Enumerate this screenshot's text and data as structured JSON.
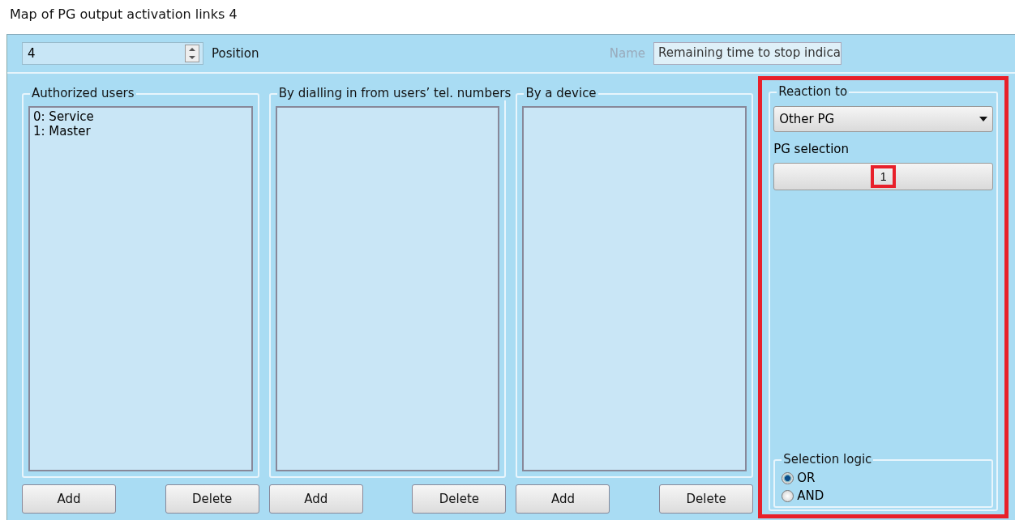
{
  "window": {
    "title": "Map of PG output activation links 4"
  },
  "toolbar": {
    "position_value": "4",
    "position_label": "Position",
    "name_label": "Name",
    "name_value": "Remaining time to stop indica"
  },
  "groups": [
    {
      "title": "Authorized users",
      "items": [
        "0: Service",
        "1: Master"
      ],
      "buttons": [
        "Add",
        "Delete"
      ]
    },
    {
      "title": "By dialling in from users’ tel. numbers",
      "buttons": [
        "Add",
        "Delete"
      ]
    },
    {
      "title": "By a device",
      "buttons": [
        "Add",
        "Delete"
      ]
    }
  ],
  "reaction": {
    "title": "Reaction to",
    "dropdown_value": "Other PG",
    "pg_label": "PG selection",
    "pg_value": "1",
    "highlighted": true,
    "logic": {
      "title": "Selection logic",
      "options": [
        {
          "label": "OR",
          "selected": true
        },
        {
          "label": "AND",
          "selected": false
        }
      ]
    }
  }
}
